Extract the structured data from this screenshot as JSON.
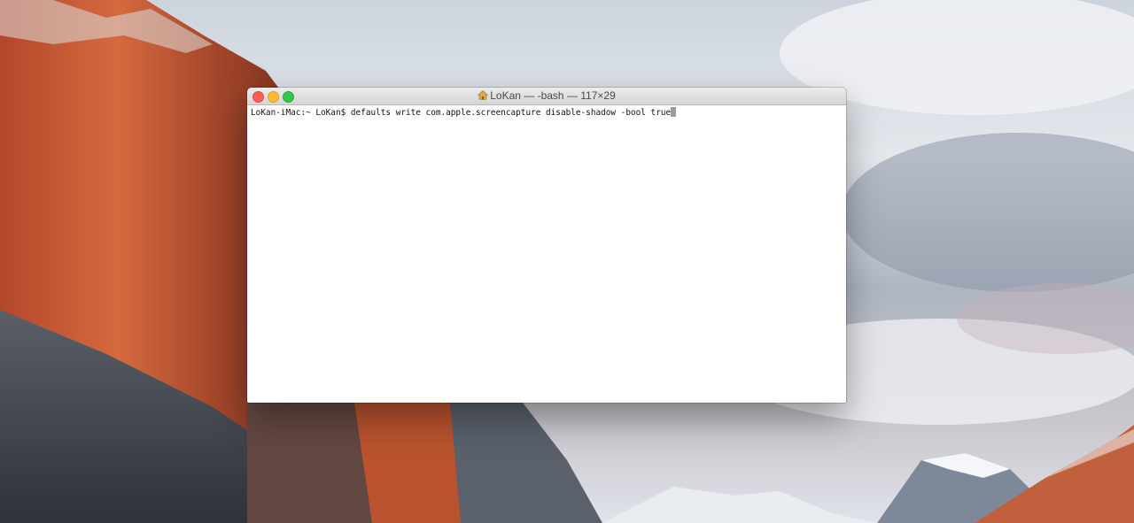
{
  "window": {
    "title": "LoKan — -bash — 117×29",
    "title_icon": "home-icon"
  },
  "terminal": {
    "prompt": "LoKan-iMac:~ LoKan$ ",
    "command": "defaults write com.apple.screencapture disable-shadow -bool true"
  },
  "colors": {
    "close": "#fc5f57",
    "minimize": "#fdbc2e",
    "zoom": "#33c748"
  }
}
